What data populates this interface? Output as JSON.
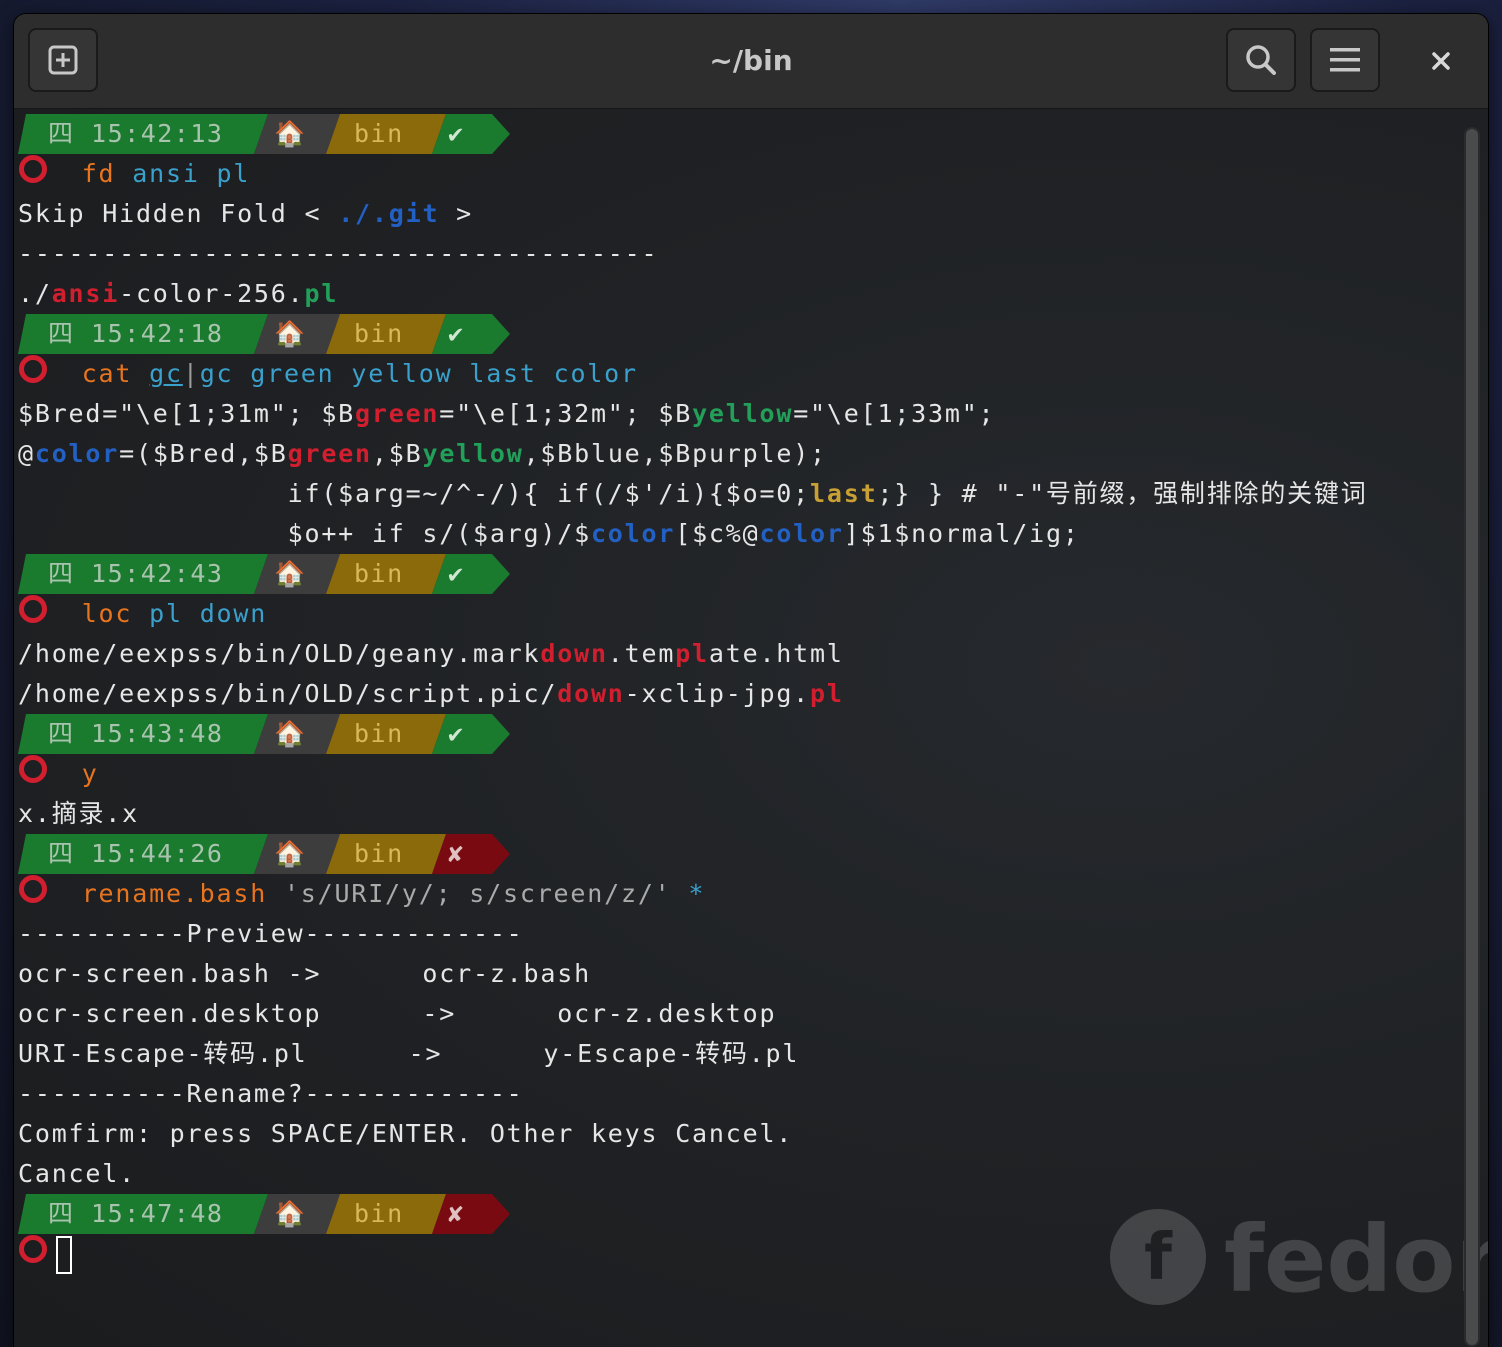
{
  "window": {
    "title": "~/bin"
  },
  "headerbar": {
    "new_tab_icon": "new-tab-icon",
    "search_icon": "search-icon",
    "menu_icon": "hamburger-menu-icon",
    "close_symbol": "×"
  },
  "colors": {
    "prompt_green": "#1a7a2e",
    "prompt_gold": "#8a6a0a",
    "prompt_gray": "#3d3d3d",
    "prompt_error": "#7a0a12",
    "cmd_orange": "#e7741f",
    "arg_cyan": "#3aa0cc",
    "match_red": "#d11f2f"
  },
  "prompts": [
    {
      "day": "四",
      "time": "15:42:13",
      "home_icon": "🏠",
      "dir": "bin",
      "status": "✔",
      "ok": true
    },
    {
      "day": "四",
      "time": "15:42:18",
      "home_icon": "🏠",
      "dir": "bin",
      "status": "✔",
      "ok": true
    },
    {
      "day": "四",
      "time": "15:42:43",
      "home_icon": "🏠",
      "dir": "bin",
      "status": "✔",
      "ok": true
    },
    {
      "day": "四",
      "time": "15:43:48",
      "home_icon": "🏠",
      "dir": "bin",
      "status": "✔",
      "ok": true
    },
    {
      "day": "四",
      "time": "15:44:26",
      "home_icon": "🏠",
      "dir": "bin",
      "status": "✘",
      "ok": false
    },
    {
      "day": "四",
      "time": "15:47:48",
      "home_icon": "🏠",
      "dir": "bin",
      "status": "✘",
      "ok": false
    }
  ],
  "block1": {
    "cmd": "fd",
    "arg1": "ansi",
    "arg2": "pl",
    "skip_prefix": "Skip Hidden Fold < ",
    "skip_path": "./.git",
    "skip_suffix": " >",
    "dashes": "--------------------------------------",
    "res_prefix": "./",
    "res_match": "ansi",
    "res_mid": "-color-256.",
    "res_ext": "pl"
  },
  "block2": {
    "cmd": "cat",
    "gc1": "gc",
    "pipe": "|",
    "gc2": "gc",
    "args": [
      "green",
      "yellow",
      "last",
      "color"
    ],
    "l1a": "$Bred=\"\\e[1;31m\"; $B",
    "l1b": "green",
    "l1c": "=\"\\e[1;32m\"; $B",
    "l1d": "yellow",
    "l1e": "=\"\\e[1;33m\";",
    "l2a": "@",
    "l2b": "color",
    "l2c": "=($Bred,$B",
    "l2d": "green",
    "l2e": ",$B",
    "l2f": "yellow",
    "l2g": ",$Bblue,$Bpurple);",
    "l3a": "                if($arg=~/^-/){ if(/$'/i){$o=0;",
    "l3b": "last",
    "l3c": ";} } # \"-\"号前缀，强制排除的关键词",
    "l4a": "                $o++ if s/($arg)/$",
    "l4b": "color",
    "l4c": "[$c%@",
    "l4d": "color",
    "l4e": "]$1$normal/ig;"
  },
  "block3": {
    "cmd": "loc",
    "arg1": "pl",
    "arg2": "down",
    "r1a": "/home/eexpss/bin/OLD/geany.mark",
    "r1b": "down",
    "r1c": ".tem",
    "r1d": "pl",
    "r1e": "ate.html",
    "r2a": "/home/eexpss/bin/OLD/script.pic/",
    "r2b": "down",
    "r2c": "-xclip-jpg.",
    "r2d": "pl"
  },
  "block4": {
    "cmd": "y",
    "out": "x.摘录.x"
  },
  "block5": {
    "cmd": "rename.bash",
    "arg": "'s/URI/y/; s/screen/z/'",
    "glob": "*",
    "preview": "----------Preview-------------",
    "rows": [
      "ocr-screen.bash ->      ocr-z.bash",
      "ocr-screen.desktop      ->      ocr-z.desktop",
      "URI-Escape-转码.pl      ->      y-Escape-转码.pl"
    ],
    "rename": "----------Rename?-------------",
    "confirm": "Comfirm: press SPACE/ENTER. Other keys Cancel.",
    "cancel": "Cancel."
  },
  "watermark_text": "fedora"
}
